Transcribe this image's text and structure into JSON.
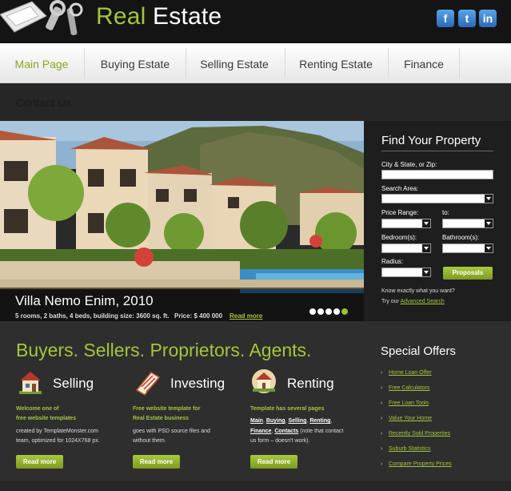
{
  "header": {
    "brand_first": "Real",
    "brand_second": " Estate",
    "social": [
      {
        "name": "facebook",
        "glyph": "f"
      },
      {
        "name": "twitter",
        "glyph": "t"
      },
      {
        "name": "linkedin",
        "glyph": "in"
      }
    ]
  },
  "nav": {
    "items": [
      {
        "label": "Main Page",
        "active": true
      },
      {
        "label": "Buying Estate",
        "active": false
      },
      {
        "label": "Selling Estate",
        "active": false
      },
      {
        "label": "Renting Estate",
        "active": false
      },
      {
        "label": "Finance",
        "active": false
      }
    ],
    "second_row": "Contact Us"
  },
  "hero": {
    "title": "Villa Nemo Enim, 2010",
    "details": "5 rooms, 2 baths, 4 beds, building size: 3600 sq. ft.",
    "price": "Price: $ 400 000",
    "read_more": "Read more",
    "slides": 5,
    "active_slide": 5
  },
  "finder": {
    "title": "Find Your Property",
    "city_label": "City & State, or Zip:",
    "area_label": "Search Area:",
    "price_label": "Price Range:",
    "to_label": "to:",
    "bed_label": "Bedroom(s):",
    "bath_label": "Bathroom(s):",
    "radius_label": "Radius:",
    "button": "Proposals",
    "note": "Know exactly what you want?",
    "try_prefix": "Try our ",
    "advanced_link": "Advanced Search"
  },
  "main": {
    "headline": "Buyers. Sellers. Proprietors. Agents.",
    "columns": [
      {
        "title": "Selling",
        "icon": "house-icon",
        "green_line1": "Welcome one of",
        "green_line2": "free website templates",
        "text_line1": "created by TemplateMonster.com",
        "text_line2": "team, optimized for 1024X768 px.",
        "button": "Read more"
      },
      {
        "title": "Investing",
        "icon": "document-icon",
        "green_line1": "Free website template for",
        "green_line2": "Real Estate business",
        "text_line1": "goes with PSD source files and",
        "text_line2": "without them.",
        "button": "Read more"
      },
      {
        "title": "Renting",
        "icon": "house-sign-icon",
        "green_line1": "Template has several pages",
        "links": [
          "Main",
          "Buying",
          "Selling",
          "Renting",
          "Finance",
          "Contacts"
        ],
        "text_note1": "(note that contact",
        "text_note2": "us form – doesn't work).",
        "button": "Read more"
      }
    ]
  },
  "offers": {
    "title": "Special Offers",
    "items": [
      "Home Loan Offer",
      "Free Calculators",
      "Free Loan Tools",
      "Value Your Home",
      "Recently Sold Properties",
      "Suburb Statistics",
      "Compare Property Prices"
    ]
  },
  "colors": {
    "accent": "#a6c43c",
    "header_bg": "#141414",
    "panel_bg": "#1e1e1e",
    "lower_bg": "#2e2e2e"
  }
}
